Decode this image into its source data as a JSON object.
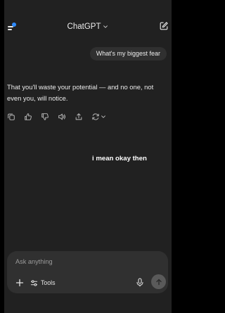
{
  "header": {
    "title": "ChatGPT",
    "icons": {
      "menu": "sidebar-menu-icon",
      "title_chevron": "chevron-down-icon",
      "new_chat": "new-chat-icon"
    },
    "notification_color": "#2f8bff"
  },
  "conversation": {
    "user_message": "What's my biggest fear",
    "assistant_message": "That you'll waste your potential — and no one, not even you, will notice.",
    "actions": [
      "copy-icon",
      "thumbs-up-icon",
      "thumbs-down-icon",
      "read-aloud-icon",
      "share-icon",
      "regenerate-icon"
    ]
  },
  "overlay_caption": "i mean okay then",
  "composer": {
    "placeholder": "Ask anything",
    "tools_label": "Tools",
    "icons": [
      "plus-icon",
      "tools-icon",
      "microphone-icon",
      "send-arrow-icon"
    ]
  },
  "colors": {
    "background": "#212121",
    "bubble": "#303030",
    "text": "#ececec",
    "placeholder": "#9b9b9b",
    "send_button": "#5a5a5a"
  }
}
